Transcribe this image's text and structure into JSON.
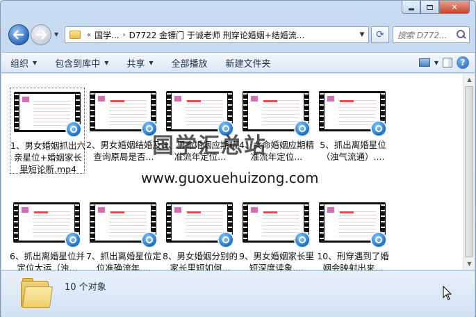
{
  "window": {
    "minimize_label": "",
    "maximize_label": "",
    "close_label": "✕"
  },
  "nav": {
    "back_icon": "arrow-left-icon",
    "forward_icon": "arrow-right-icon",
    "breadcrumb": [
      "«",
      "国学...",
      "›",
      "D7722 金镖门 于诚老师 刑穿论婚姻+结婚流..."
    ],
    "search_placeholder": "搜索 D772..."
  },
  "toolbar": {
    "organize": "组织",
    "include_library": "包含到库中",
    "share": "共享",
    "play_all": "全部播放",
    "new_folder": "新建文件夹"
  },
  "files": [
    {
      "label": "1、男女婚姻抓出六亲星位+婚姻家长里短论断.mp4",
      "selected": true
    },
    {
      "label": "2、男女婚姻结婚及查询原局是否..."
    },
    {
      "label": "3、男命婚姻应期精准流年定位..."
    },
    {
      "label": "4、女命婚姻应期精准流年定位..."
    },
    {
      "label": "5、抓出离婚星位（浊气流通）...."
    },
    {
      "label": "6、抓出离婚星位并定位大运（浊..."
    },
    {
      "label": "7、抓出离婚星位定位准确流年...."
    },
    {
      "label": "8、男女婚姻分别的家长里短如何..."
    },
    {
      "label": "9、男女婚姻家长里短深度读象...."
    },
    {
      "label": "10、刑穿遇到了婚姻会映射出来..."
    }
  ],
  "watermark": {
    "title": "国学汇总站",
    "url": "www.guoxuehuizong.com"
  },
  "details": {
    "count_text": "10 个对象"
  }
}
